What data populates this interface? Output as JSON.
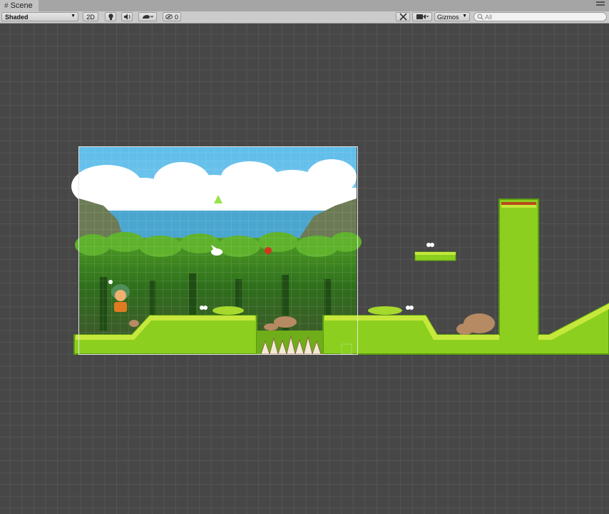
{
  "window": {
    "tab_title": "Scene"
  },
  "toolbar": {
    "draw_mode": "Shaded",
    "mode_2d": "2D",
    "hidden_count": "0",
    "gizmos_label": "Gizmos",
    "search_placeholder": "All",
    "icons": [
      "lighting-icon",
      "audio-icon",
      "effects-icon",
      "eye-icon",
      "tools-icon",
      "camera-icon",
      "search-icon"
    ]
  },
  "scene": {
    "colors": {
      "ground": "#8ccf1f",
      "ground_dark": "#5a9a12",
      "ground_light": "#c6e83c",
      "sky": "#76c9ee",
      "sea": "#4aa6cf",
      "jungle": "#2f7a1e",
      "grid": "#545454",
      "background": "#474747"
    }
  }
}
